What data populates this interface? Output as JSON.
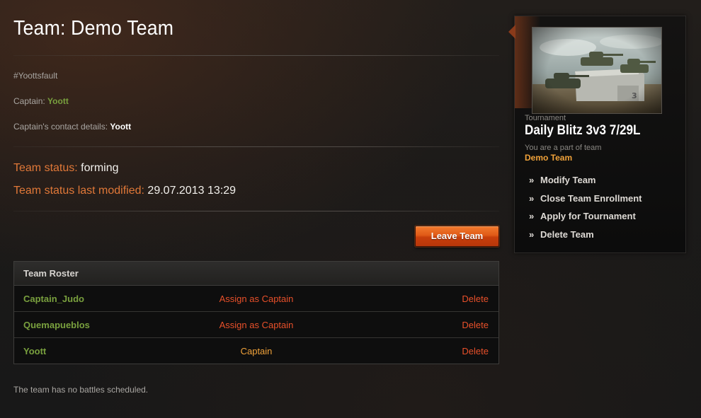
{
  "page": {
    "title": "Team: Demo Team",
    "tag": "#Yoottsfault",
    "captain_label": "Captain:",
    "captain_name": "Yoott",
    "contact_label": "Captain's contact details:",
    "contact_value": "Yoott",
    "status_label": "Team status:",
    "status_value": "forming",
    "modified_label": "Team status last modified:",
    "modified_value": "29.07.2013 13:29",
    "leave_button": "Leave Team",
    "no_battles": "The team has no battles scheduled."
  },
  "roster": {
    "header": "Team Roster",
    "rows": [
      {
        "name": "Captain_Judo",
        "role_action": "Assign as Captain",
        "is_captain": false,
        "delete": "Delete"
      },
      {
        "name": "Quemapueblos",
        "role_action": "Assign as Captain",
        "is_captain": false,
        "delete": "Delete"
      },
      {
        "name": "Yoott",
        "role_action": "Captain",
        "is_captain": true,
        "delete": "Delete"
      }
    ]
  },
  "sidebar": {
    "tournament_label": "Tournament",
    "tournament_name": "Daily Blitz 3v3 7/29L",
    "part_of_label": "You are a part of team",
    "team_name": "Demo Team",
    "actions": [
      {
        "label": "Modify Team",
        "icon": "double-chevron-right-icon"
      },
      {
        "label": "Close Team Enrollment",
        "icon": "double-chevron-right-icon"
      },
      {
        "label": "Apply for Tournament",
        "icon": "double-chevron-right-icon"
      },
      {
        "label": "Delete Team",
        "icon": "double-chevron-right-icon"
      }
    ]
  },
  "colors": {
    "accent_orange": "#e07838",
    "link_red": "#e8502a",
    "name_green": "#79a03e",
    "captain_gold": "#f0a23a"
  }
}
